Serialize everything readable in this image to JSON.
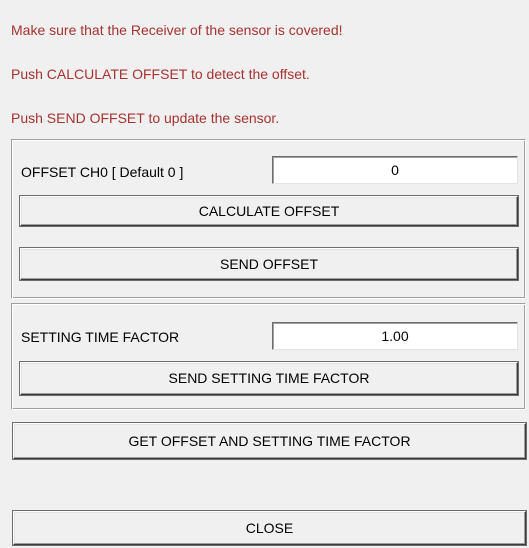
{
  "messages": {
    "line1": "Make sure that the Receiver of the sensor is covered!",
    "line2": "Push CALCULATE OFFSET to detect the offset.",
    "line3": "Push SEND OFFSET to update the sensor."
  },
  "offset_group": {
    "label": "OFFSET CH0 [ Default 0 ]",
    "value": "0",
    "calculate_button": "CALCULATE OFFSET",
    "send_button": "SEND OFFSET"
  },
  "setting_time_group": {
    "label": "SETTING TIME FACTOR",
    "value": "1.00",
    "send_button": "SEND SETTING TIME FACTOR"
  },
  "get_button": "GET OFFSET AND SETTING TIME FACTOR",
  "close_button": "CLOSE",
  "colors": {
    "message_text": "#a63232",
    "background": "#f0f0f0"
  }
}
